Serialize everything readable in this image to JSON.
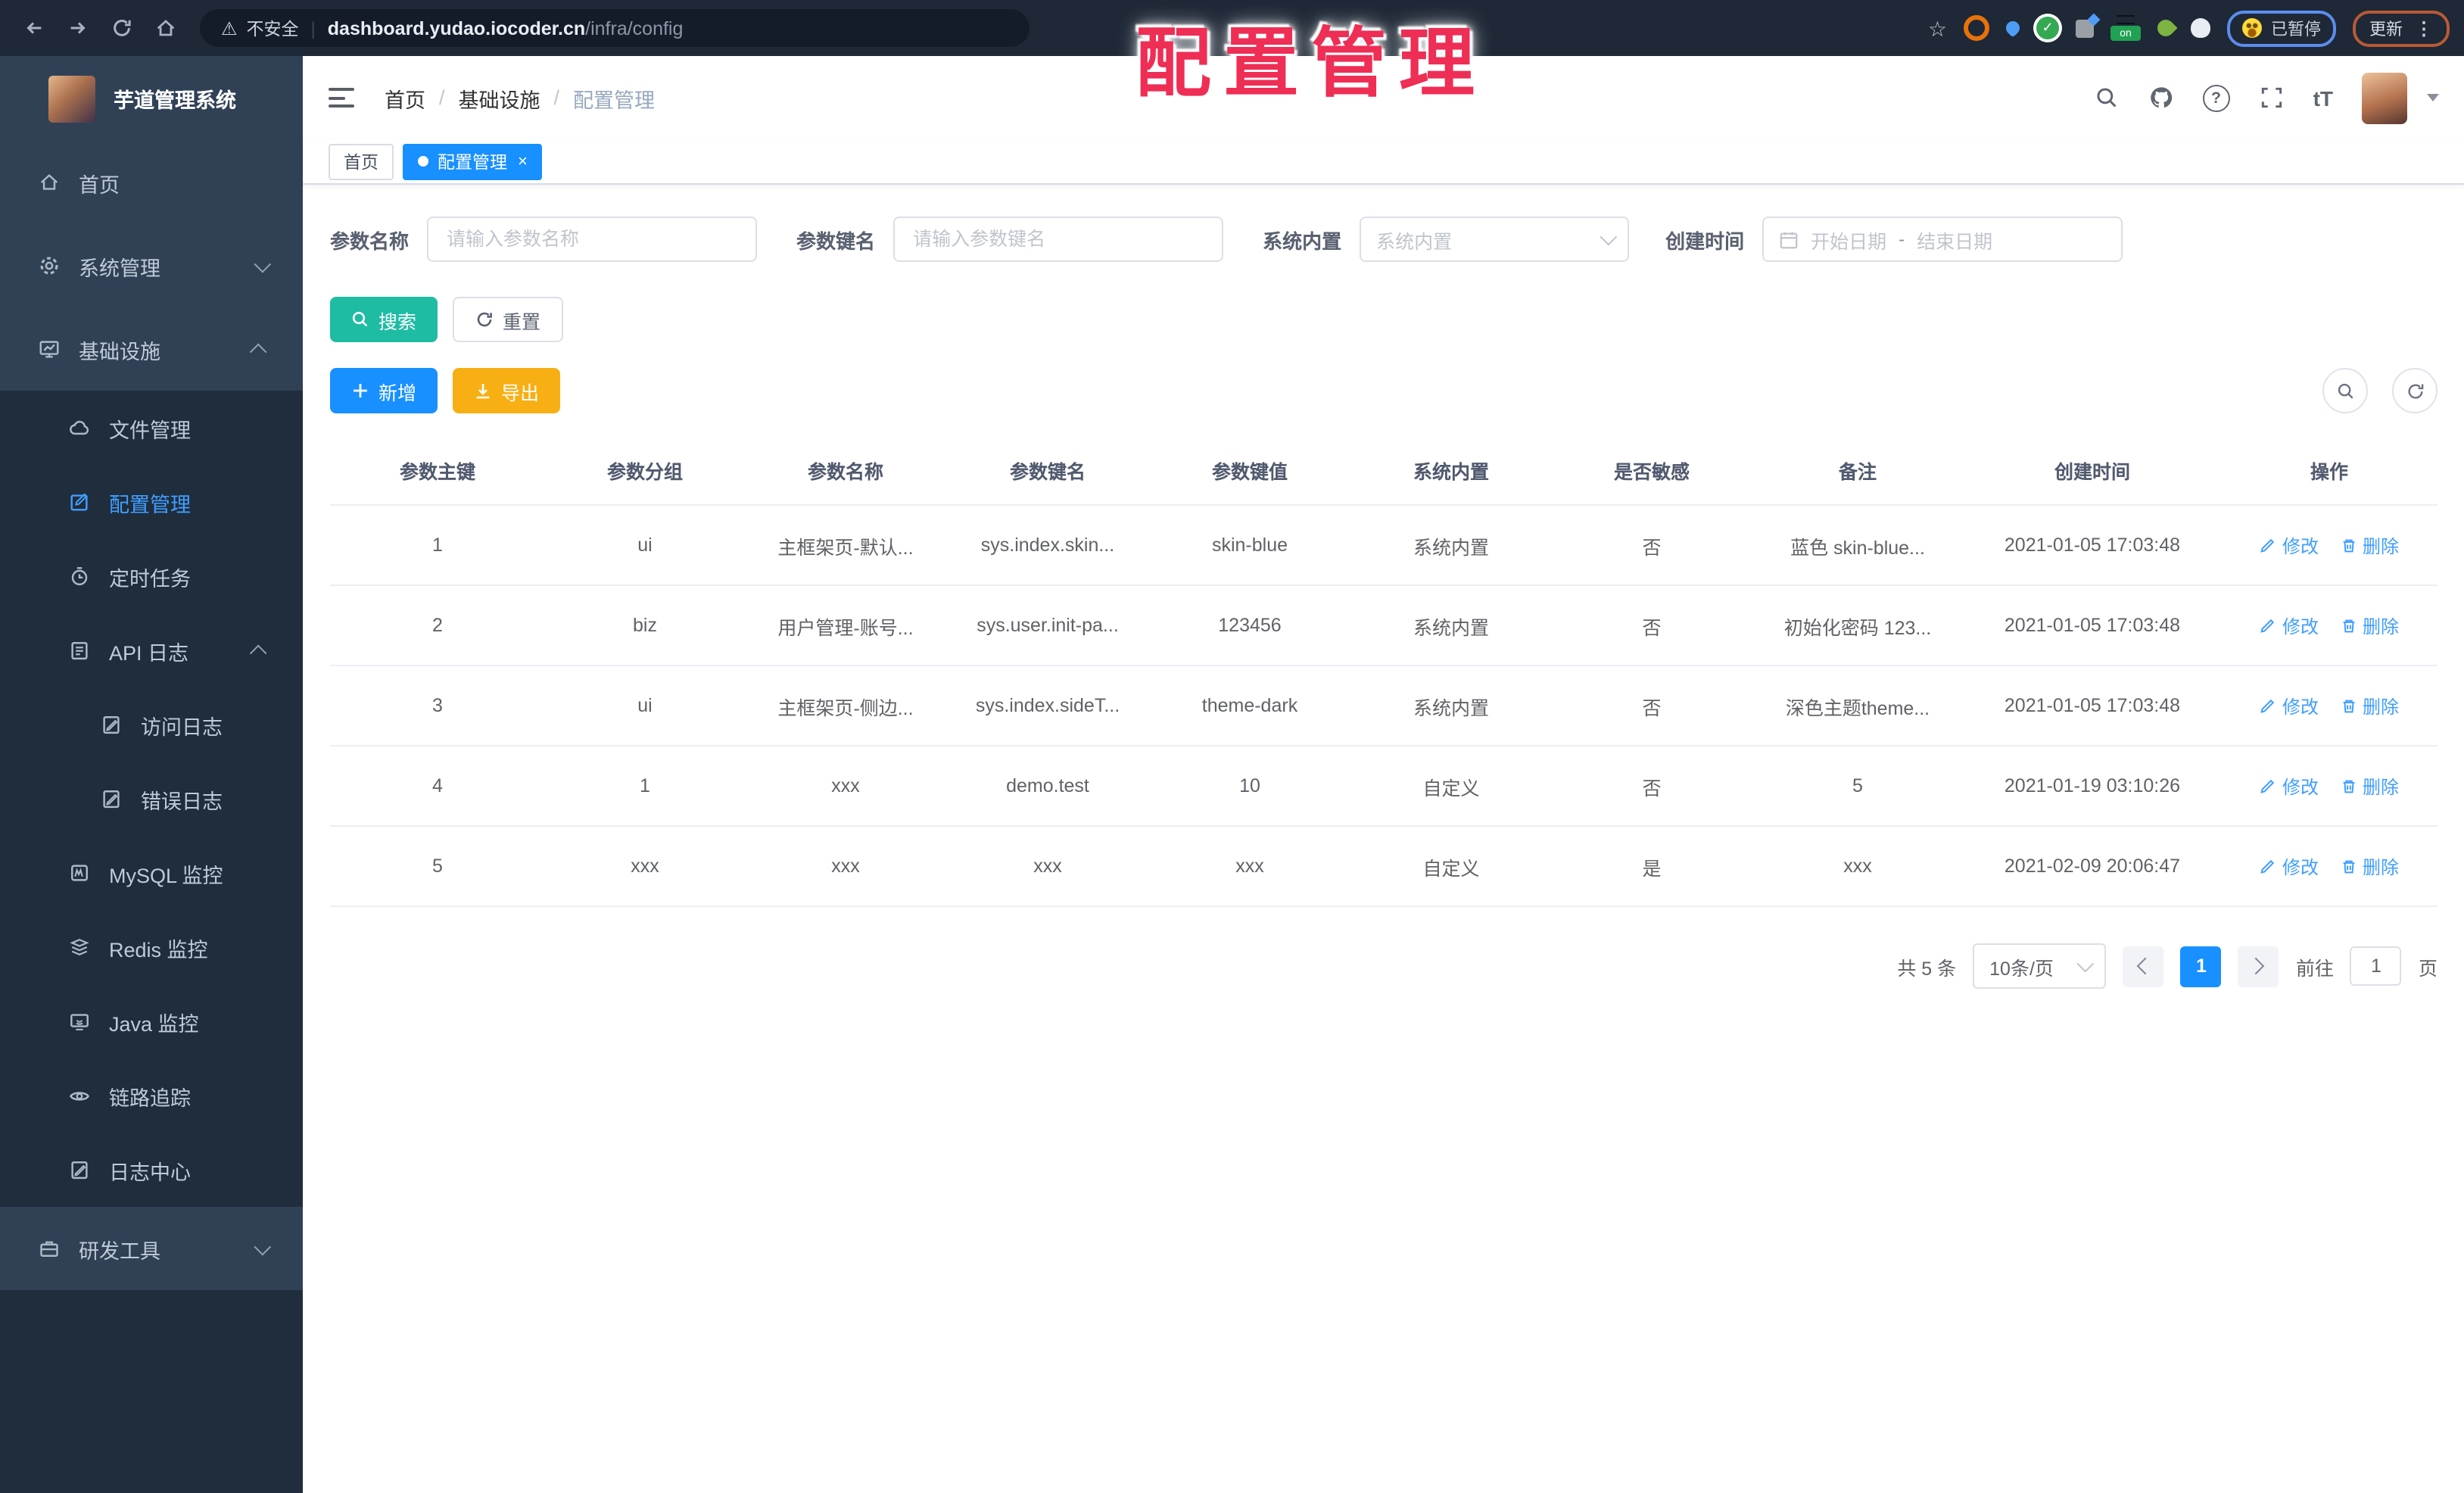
{
  "colors": {
    "primary": "#1890ff",
    "link": "#409eff",
    "search_teal": "#1fbca4",
    "export_amber": "#f7af13",
    "overlay_red": "#ee2e55",
    "sidebar_bg": "#304156",
    "submenu_bg": "#1f2d3d"
  },
  "overlay_title": "配置管理",
  "glyphs": {
    "warning": "⚠",
    "star": "☆",
    "check": "✓",
    "help": "?",
    "menu_dots": "⋮",
    "close": "×",
    "url_separator": "|",
    "breadcrumb_separator": "/"
  },
  "browser": {
    "security": "不安全",
    "url_domain": "dashboard.yudao.iocoder.cn",
    "url_path": "/infra/config",
    "on_badge": "on",
    "paused_badge": "已暂停",
    "update_button": "更新"
  },
  "sidebar": {
    "app_title": "芋道管理系统",
    "items": [
      {
        "label": "首页"
      },
      {
        "label": "系统管理"
      },
      {
        "label": "基础设施"
      },
      {
        "label": "文件管理"
      },
      {
        "label": "配置管理"
      },
      {
        "label": "定时任务"
      },
      {
        "label": "API 日志"
      },
      {
        "label": "访问日志"
      },
      {
        "label": "错误日志"
      },
      {
        "label": "MySQL 监控"
      },
      {
        "label": "Redis 监控"
      },
      {
        "label": "Java 监控"
      },
      {
        "label": "链路追踪"
      },
      {
        "label": "日志中心"
      },
      {
        "label": "研发工具"
      }
    ]
  },
  "navbar": {
    "breadcrumb": [
      "首页",
      "基础设施",
      "配置管理"
    ],
    "font_icon": "tT"
  },
  "tabs": {
    "home": "首页",
    "active": "配置管理"
  },
  "filters": {
    "name_label": "参数名称",
    "name_placeholder": "请输入参数名称",
    "key_label": "参数键名",
    "key_placeholder": "请输入参数键名",
    "builtin_label": "系统内置",
    "builtin_placeholder": "系统内置",
    "time_label": "创建时间",
    "start_placeholder": "开始日期",
    "range_separator": "-",
    "end_placeholder": "结束日期"
  },
  "toolbar": {
    "search": "搜索",
    "reset": "重置",
    "add": "新增",
    "export": "导出"
  },
  "table": {
    "headers": [
      "参数主键",
      "参数分组",
      "参数名称",
      "参数键名",
      "参数键值",
      "系统内置",
      "是否敏感",
      "备注",
      "创建时间",
      "操作"
    ],
    "edit": "修改",
    "delete": "删除",
    "rows": [
      {
        "id": "1",
        "group": "ui",
        "name": "主框架页-默认...",
        "key": "sys.index.skin...",
        "value": "skin-blue",
        "builtin": "系统内置",
        "sensitive": "否",
        "remark": "蓝色 skin-blue...",
        "created": "2021-01-05 17:03:48"
      },
      {
        "id": "2",
        "group": "biz",
        "name": "用户管理-账号...",
        "key": "sys.user.init-pa...",
        "value": "123456",
        "builtin": "系统内置",
        "sensitive": "否",
        "remark": "初始化密码 123...",
        "created": "2021-01-05 17:03:48"
      },
      {
        "id": "3",
        "group": "ui",
        "name": "主框架页-侧边...",
        "key": "sys.index.sideT...",
        "value": "theme-dark",
        "builtin": "系统内置",
        "sensitive": "否",
        "remark": "深色主题theme...",
        "created": "2021-01-05 17:03:48"
      },
      {
        "id": "4",
        "group": "1",
        "name": "xxx",
        "key": "demo.test",
        "value": "10",
        "builtin": "自定义",
        "sensitive": "否",
        "remark": "5",
        "created": "2021-01-19 03:10:26"
      },
      {
        "id": "5",
        "group": "xxx",
        "name": "xxx",
        "key": "xxx",
        "value": "xxx",
        "builtin": "自定义",
        "sensitive": "是",
        "remark": "xxx",
        "created": "2021-02-09 20:06:47"
      }
    ]
  },
  "pagination": {
    "total": "共 5 条",
    "page_size": "10条/页",
    "page": "1",
    "goto": "前往",
    "goto_value": "1",
    "unit": "页"
  }
}
